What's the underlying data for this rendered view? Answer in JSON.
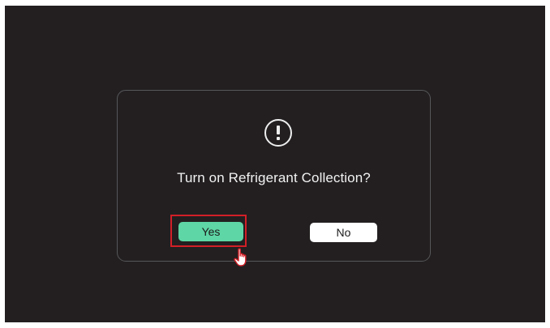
{
  "dialog": {
    "icon": "exclamation-circle-icon",
    "message": "Turn on Refrigerant Collection?",
    "yes_label": "Yes",
    "no_label": "No"
  },
  "cursor": {
    "icon": "hand-pointer-icon"
  },
  "colors": {
    "background": "#231f20",
    "dialog_border": "#56575a",
    "yes_button": "#5ed6a5",
    "no_button": "#ffffff",
    "highlight": "#d21f27",
    "text": "#f2f2f2"
  }
}
